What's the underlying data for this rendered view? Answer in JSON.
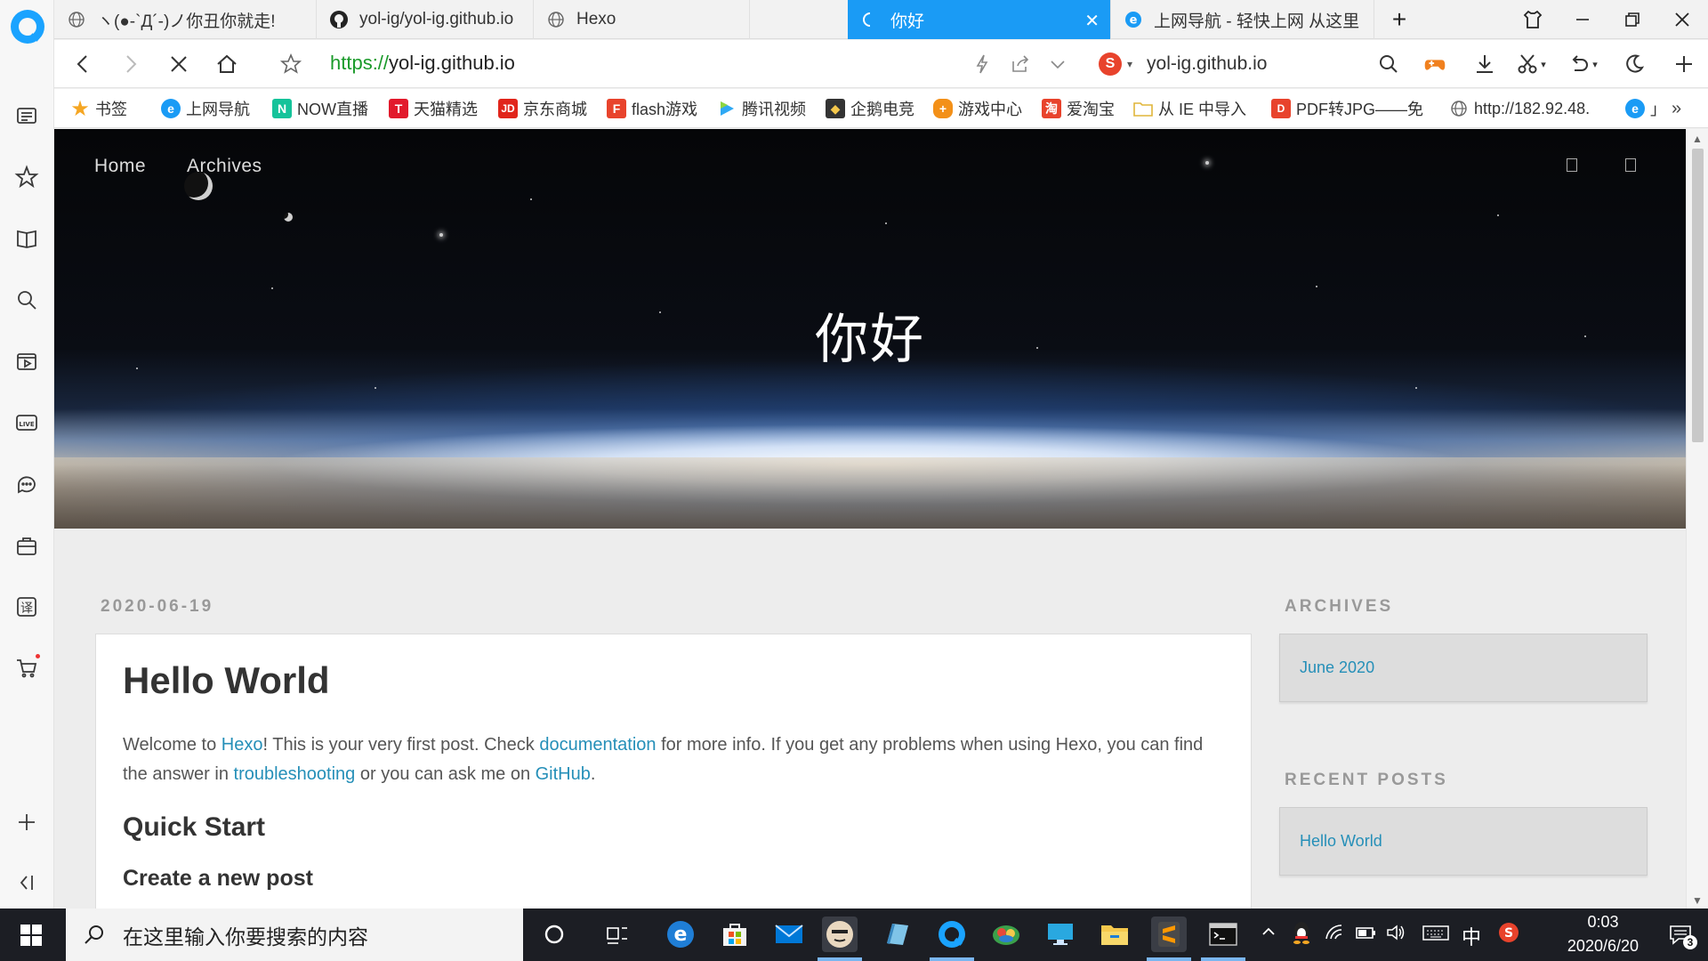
{
  "browser": {
    "tabs": [
      {
        "label": "ヽ(●-`Д´-)ノ你丑你就走!",
        "icon": "globe-icon"
      },
      {
        "label": "yol-ig/yol-ig.github.io",
        "icon": "github-icon"
      },
      {
        "label": "Hexo",
        "icon": "globe-icon"
      },
      {
        "label": "你好",
        "icon": "loading-icon"
      },
      {
        "label": "上网导航 - 轻快上网 从这里",
        "icon": "ie-icon"
      }
    ],
    "new_tab": "+",
    "address": {
      "scheme": "https://",
      "host": "yol-ig.github.io"
    },
    "search_engine": {
      "logo": "S",
      "query": "yol-ig.github.io"
    }
  },
  "bookmarks": [
    {
      "label": "书签",
      "icon": "star-icon",
      "color": "#f5a623"
    },
    {
      "label": "上网导航",
      "icon": "ie-icon",
      "color": "#1a9bf5"
    },
    {
      "label": "NOW直播",
      "icon": "now-icon",
      "color": "#15c39a"
    },
    {
      "label": "天猫精选",
      "icon": "tmall-icon",
      "color": "#e21a2c"
    },
    {
      "label": "京东商城",
      "icon": "jd-icon",
      "color": "#e1251b"
    },
    {
      "label": "flash游戏",
      "icon": "flash-icon",
      "color": "#e8432c"
    },
    {
      "label": "腾讯视频",
      "icon": "tencent-video-icon",
      "color": "#2fa9f4"
    },
    {
      "label": "企鹅电竞",
      "icon": "penguin-esports-icon",
      "color": "#333333"
    },
    {
      "label": "游戏中心",
      "icon": "gamepad-icon",
      "color": "#f39018"
    },
    {
      "label": "爱淘宝",
      "icon": "taobao-icon",
      "color": "#e8432c"
    },
    {
      "label": "从 IE 中导入",
      "icon": "folder-icon",
      "color": "#f5c84c"
    },
    {
      "label": "PDF转JPG——免",
      "icon": "pdf-icon",
      "color": "#e8432c"
    },
    {
      "label": "http://182.92.48.",
      "icon": "globe-icon",
      "color": "#888888"
    },
    {
      "label": "」",
      "icon": "ie-icon",
      "color": "#1a9bf5"
    }
  ],
  "page": {
    "nav": [
      "Home",
      "Archives"
    ],
    "hero_title": "你好",
    "post": {
      "date": "2020-06-19",
      "title": "Hello World",
      "intro": {
        "t1": "Welcome to ",
        "l1": "Hexo",
        "t2": "! This is your very first post. Check ",
        "l2": "documentation",
        "t3": " for more info. If you get any problems when using Hexo, you can find the answer in ",
        "l3": "troubleshooting",
        "t4": " or you can ask me on ",
        "l4": "GitHub",
        "t5": "."
      },
      "h2": "Quick Start",
      "h3": "Create a new post"
    },
    "sidebar": {
      "archives_title": "ARCHIVES",
      "archives_link": "June 2020",
      "recent_title": "RECENT POSTS",
      "recent_link": "Hello World"
    }
  },
  "taskbar": {
    "search_placeholder": "在这里输入你要搜索的内容",
    "ime": "中",
    "time": "0:03",
    "date": "2020/6/20",
    "notifications": "3"
  }
}
